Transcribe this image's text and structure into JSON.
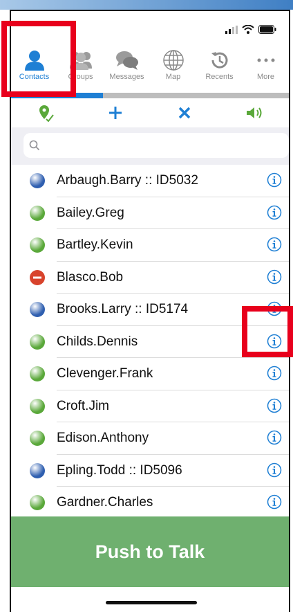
{
  "tabs": [
    {
      "label": "Contacts",
      "icon": "person-icon",
      "active": true
    },
    {
      "label": "Groups",
      "icon": "group-icon",
      "active": false
    },
    {
      "label": "Messages",
      "icon": "chat-bubbles-icon",
      "active": false
    },
    {
      "label": "Map",
      "icon": "globe-icon",
      "active": false
    },
    {
      "label": "Recents",
      "icon": "history-icon",
      "active": false
    },
    {
      "label": "More",
      "icon": "ellipsis-icon",
      "active": false
    }
  ],
  "toolbar": {
    "location_icon": "location-pin-icon",
    "add_icon": "plus-icon",
    "clear_icon": "close-icon",
    "speaker_icon": "speaker-icon"
  },
  "search": {
    "placeholder": ""
  },
  "contacts": [
    {
      "name": "Arbaugh.Barry :: ID5032",
      "status": "blue"
    },
    {
      "name": "Bailey.Greg",
      "status": "green"
    },
    {
      "name": "Bartley.Kevin",
      "status": "green"
    },
    {
      "name": "Blasco.Bob",
      "status": "busy"
    },
    {
      "name": "Brooks.Larry :: ID5174",
      "status": "blue"
    },
    {
      "name": "Childs.Dennis",
      "status": "green"
    },
    {
      "name": "Clevenger.Frank",
      "status": "green"
    },
    {
      "name": "Croft.Jim",
      "status": "green"
    },
    {
      "name": "Edison.Anthony",
      "status": "green"
    },
    {
      "name": "Epling.Todd :: ID5096",
      "status": "blue"
    },
    {
      "name": "Gardner.Charles",
      "status": "green"
    }
  ],
  "push_to_talk": {
    "label": "Push to Talk"
  },
  "colors": {
    "accent": "#1e7fd4",
    "online": "#5aa83a",
    "blue": "#2f5fb0",
    "busy": "#d8432c",
    "ptt": "#6fb06f",
    "highlight": "#e8001c"
  }
}
